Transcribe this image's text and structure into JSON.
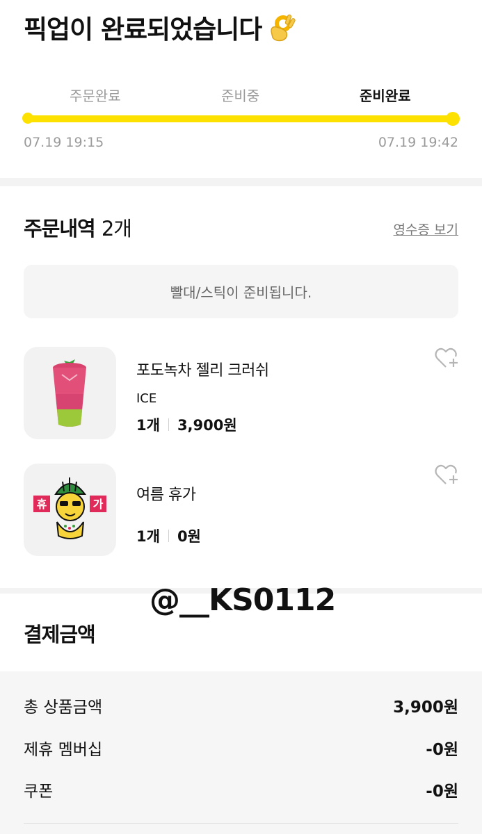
{
  "header": {
    "title": "픽업이 완료되었습니다",
    "title_emoji": "ok-hand-emoji"
  },
  "progress": {
    "steps": [
      "주문완료",
      "준비중",
      "준비완료"
    ],
    "current_step": 3,
    "percent": 100,
    "start_time": "07.19 19:15",
    "end_time": "07.19 19:42",
    "accent": "#fde100"
  },
  "order": {
    "title": "주문내역",
    "count": "2개",
    "receipt_link": "영수증 보기",
    "notice": "빨대/스틱이 준비됩니다.",
    "items": [
      {
        "name": "포도녹차 젤리 크러쉬",
        "option": "ICE",
        "qty": "1개",
        "price": "3,900원",
        "icon": "drink-cup-icon"
      },
      {
        "name": "여름 휴가",
        "option": "",
        "qty": "1개",
        "price": "0원",
        "icon": "summer-vacation-sticker-icon",
        "sticker_text": [
          "휴",
          "가"
        ]
      }
    ]
  },
  "watermark": "@__KS0112",
  "payment": {
    "title": "결제금액",
    "rows": [
      {
        "label": "총 상품금액",
        "value": "3,900원"
      },
      {
        "label": "제휴 멤버십",
        "value": "-0원"
      },
      {
        "label": "쿠폰",
        "value": "-0원"
      }
    ]
  }
}
